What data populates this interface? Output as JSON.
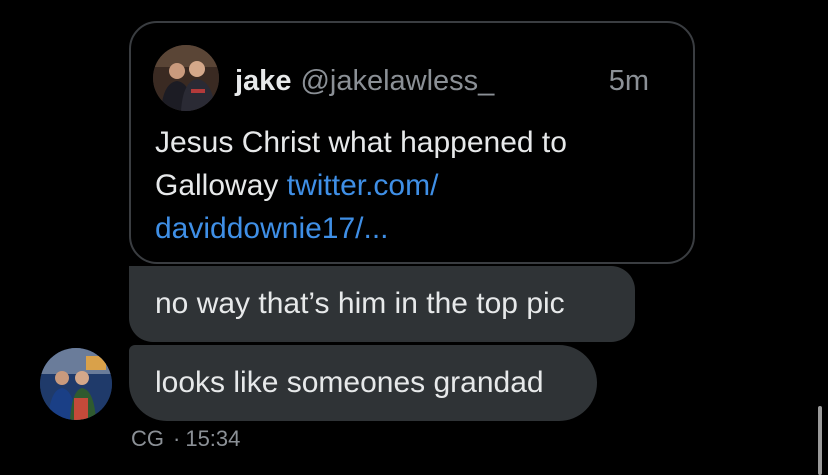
{
  "quoted_tweet": {
    "name": "jake",
    "handle": "@jakelawless_",
    "time": "5m",
    "text_line_1": "Jesus Christ what happened to",
    "text_line_2_prefix": "Galloway",
    "link_line_1": "twitter.com/",
    "link_line_2": "daviddownie17/...",
    "avatar_icon": "profile-photo-two-people",
    "link_color": "#3f8fe6"
  },
  "messages": [
    {
      "text": "no way that’s him in the top pic"
    },
    {
      "text": "looks like someones grandad"
    }
  ],
  "sender": {
    "avatar_icon": "profile-photo-group",
    "initials": "CG",
    "time": "15:34",
    "separator": "·"
  },
  "colors": {
    "background": "#000000",
    "bubble": "#2f3336",
    "border": "#3a3d41",
    "secondary_text": "#8b9096"
  }
}
